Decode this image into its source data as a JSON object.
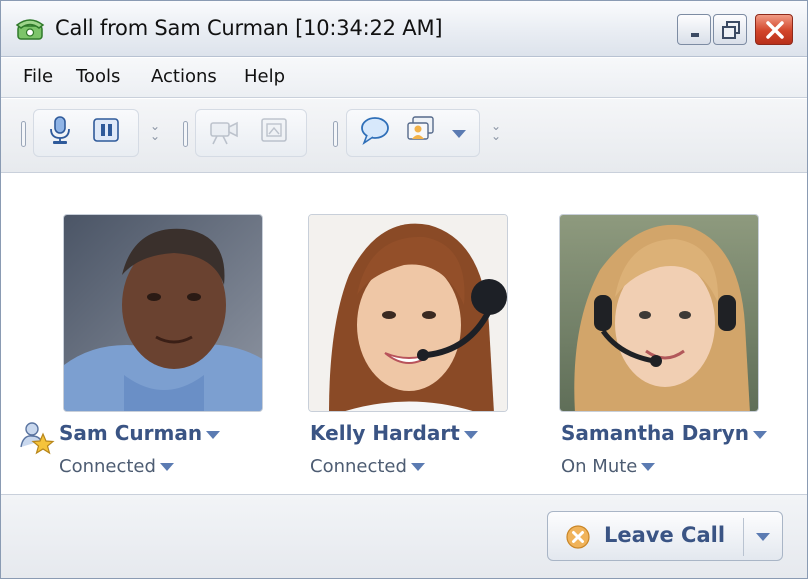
{
  "window": {
    "title": "Call from Sam Curman [10:34:22 AM]",
    "icon": "phone-icon"
  },
  "menu": [
    "File",
    "Tools",
    "Actions",
    "Help"
  ],
  "toolbar": {
    "audio_icons": [
      "microphone-icon",
      "pause-icon"
    ],
    "video_icons": [
      "video-camera-icon",
      "screen-share-icon"
    ],
    "im_icons": [
      "chat-bubble-icon",
      "participants-icon"
    ]
  },
  "participants": [
    {
      "name": "Sam Curman",
      "status": "Connected",
      "host": true
    },
    {
      "name": "Kelly Hardart",
      "status": "Connected",
      "host": false
    },
    {
      "name": "Samantha Daryn",
      "status": "On Mute",
      "host": false
    }
  ],
  "actions": {
    "leave_call": "Leave Call"
  },
  "colors": {
    "accent_text": "#3a5484",
    "close_button": "#d2452a",
    "leave_icon": "#f0b35a"
  }
}
